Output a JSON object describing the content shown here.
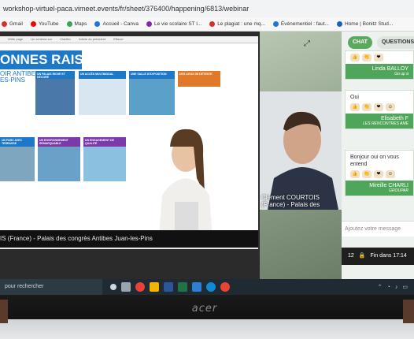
{
  "browser": {
    "url": "workshop-virtuel-paca.vimeet.events/fr/sheet/376400/happening/6813/webinar",
    "bookmarks": [
      {
        "label": "Gmail",
        "color": "#d93025"
      },
      {
        "label": "YouTube",
        "color": "#ff0000"
      },
      {
        "label": "Maps",
        "color": "#34a853"
      },
      {
        "label": "Accueil - Canva",
        "color": "#1a73e8"
      },
      {
        "label": "Le vie scolaire ST l...",
        "color": "#8e24aa"
      },
      {
        "label": "Le plagiat : une mq...",
        "color": "#d93025"
      },
      {
        "label": "Événementiel : faut...",
        "color": "#1a73e8"
      },
      {
        "label": "Home | Bonitz Stud...",
        "color": "#1565c0"
      }
    ]
  },
  "ppt": {
    "toolbar": [
      "Write page",
      "Un schéma sur",
      "Clarifier",
      "Article du président",
      "Effacer"
    ]
  },
  "slide": {
    "title": "ONNES RAISONS",
    "subtitle": "OIR ANTIBES\nES-PINS",
    "tiles": [
      {
        "label": "Un palais riche et décoré",
        "color": "#1e78c8"
      },
      {
        "label": "Un accès multimodal",
        "color": "#1e78c8"
      },
      {
        "label": "Une salle d'exposition",
        "color": "#1e78c8"
      },
      {
        "label": "Des lieux de détente",
        "color": "#e07a2a"
      },
      {
        "label": "Un parc avec terrasse",
        "color": "#1e78c8"
      },
      {
        "label": "Un environnement remarquable",
        "color": "#7b3aa8"
      },
      {
        "label": "Un engagement de qualité",
        "color": "#7b3aa8"
      }
    ]
  },
  "caption": "IS (France) - Palais des congrès Antibes Juan-les-Pins",
  "video": {
    "name": "Clément COURTOIS",
    "org": "(France) - Palais des"
  },
  "chat": {
    "tabs": [
      "CHAT",
      "QUESTIONS"
    ],
    "messages": [
      {
        "text": "",
        "author": "Linda BALLOY",
        "org": "Go up à"
      },
      {
        "text": "Oui",
        "author": "Elisabeth F",
        "org": "LES RENCONTRES AME"
      },
      {
        "text": "Bonjour oui on vous entend",
        "author": "Mireille CHARLI",
        "org": "GROUPAR"
      }
    ],
    "composer_placeholder": "Ajoutez votre message",
    "footer_count": "12",
    "footer_status": "Fin dans 17:14"
  },
  "taskbar": {
    "search_placeholder": "pour rechercher"
  },
  "laptop_brand": "acer"
}
